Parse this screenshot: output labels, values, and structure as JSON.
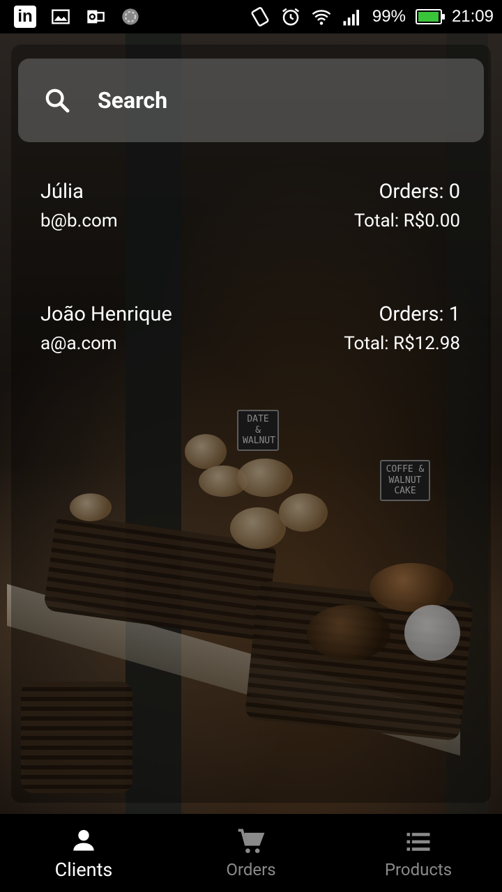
{
  "status_bar": {
    "battery": "99%",
    "time": "21:09"
  },
  "search": {
    "placeholder": "Search"
  },
  "clients": [
    {
      "name": "Júlia",
      "email": "b@b.com",
      "orders": "Orders: 0",
      "total": "Total: R$0.00"
    },
    {
      "name": "João Henrique",
      "email": "a@a.com",
      "orders": "Orders: 1",
      "total": "Total: R$12.98"
    }
  ],
  "background_signs": [
    "DATE & WALNUT",
    "COFFE & WALNUT CAKE"
  ],
  "nav": {
    "items": [
      {
        "label": "Clients",
        "icon": "person-icon",
        "active": true
      },
      {
        "label": "Orders",
        "icon": "cart-icon",
        "active": false
      },
      {
        "label": "Products",
        "icon": "list-icon",
        "active": false
      }
    ]
  },
  "colors": {
    "nav_active": "#ffffff",
    "nav_inactive": "#8a8a8a",
    "battery_fill": "#3ac43a"
  }
}
